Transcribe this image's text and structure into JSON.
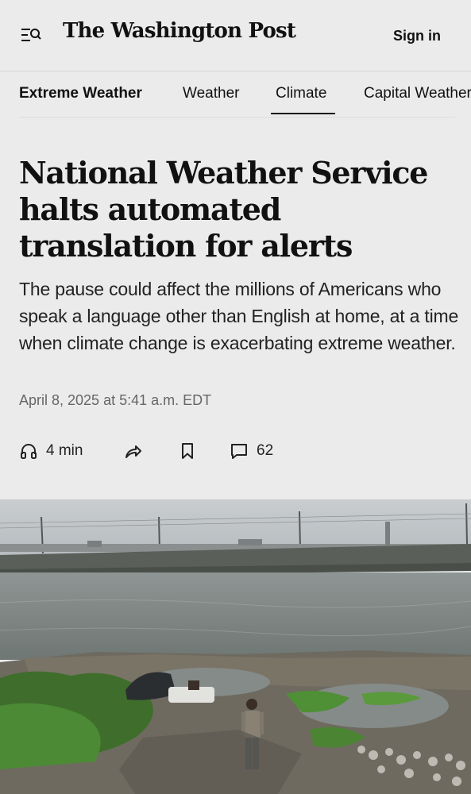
{
  "header": {
    "logo_text": "The Washington Post",
    "signin_label": "Sign in",
    "menu_icon": "menu-search-icon"
  },
  "nav": {
    "items": [
      {
        "label": "Extreme Weather",
        "bold": true
      },
      {
        "label": "Weather",
        "bold": false
      },
      {
        "label": "Climate",
        "bold": false,
        "active": true
      },
      {
        "label": "Capital Weather Gang",
        "bold": false
      }
    ]
  },
  "article": {
    "headline": "National Weather Service halts automated translation for alerts",
    "dek": "The pause could affect the millions of Americans who speak a language other than English at home, at a time when climate change is exacerbating extreme weather.",
    "date": "April 8, 2025 at 5:41 a.m. EDT",
    "actions": {
      "listen_label": "4 min",
      "listen_icon": "headphones-icon",
      "share_icon": "share-icon",
      "save_icon": "bookmark-icon",
      "comments_icon": "comment-icon",
      "comments_count": "62"
    }
  },
  "colors": {
    "background": "#ebebeb",
    "text": "#111111",
    "muted": "#666666"
  }
}
